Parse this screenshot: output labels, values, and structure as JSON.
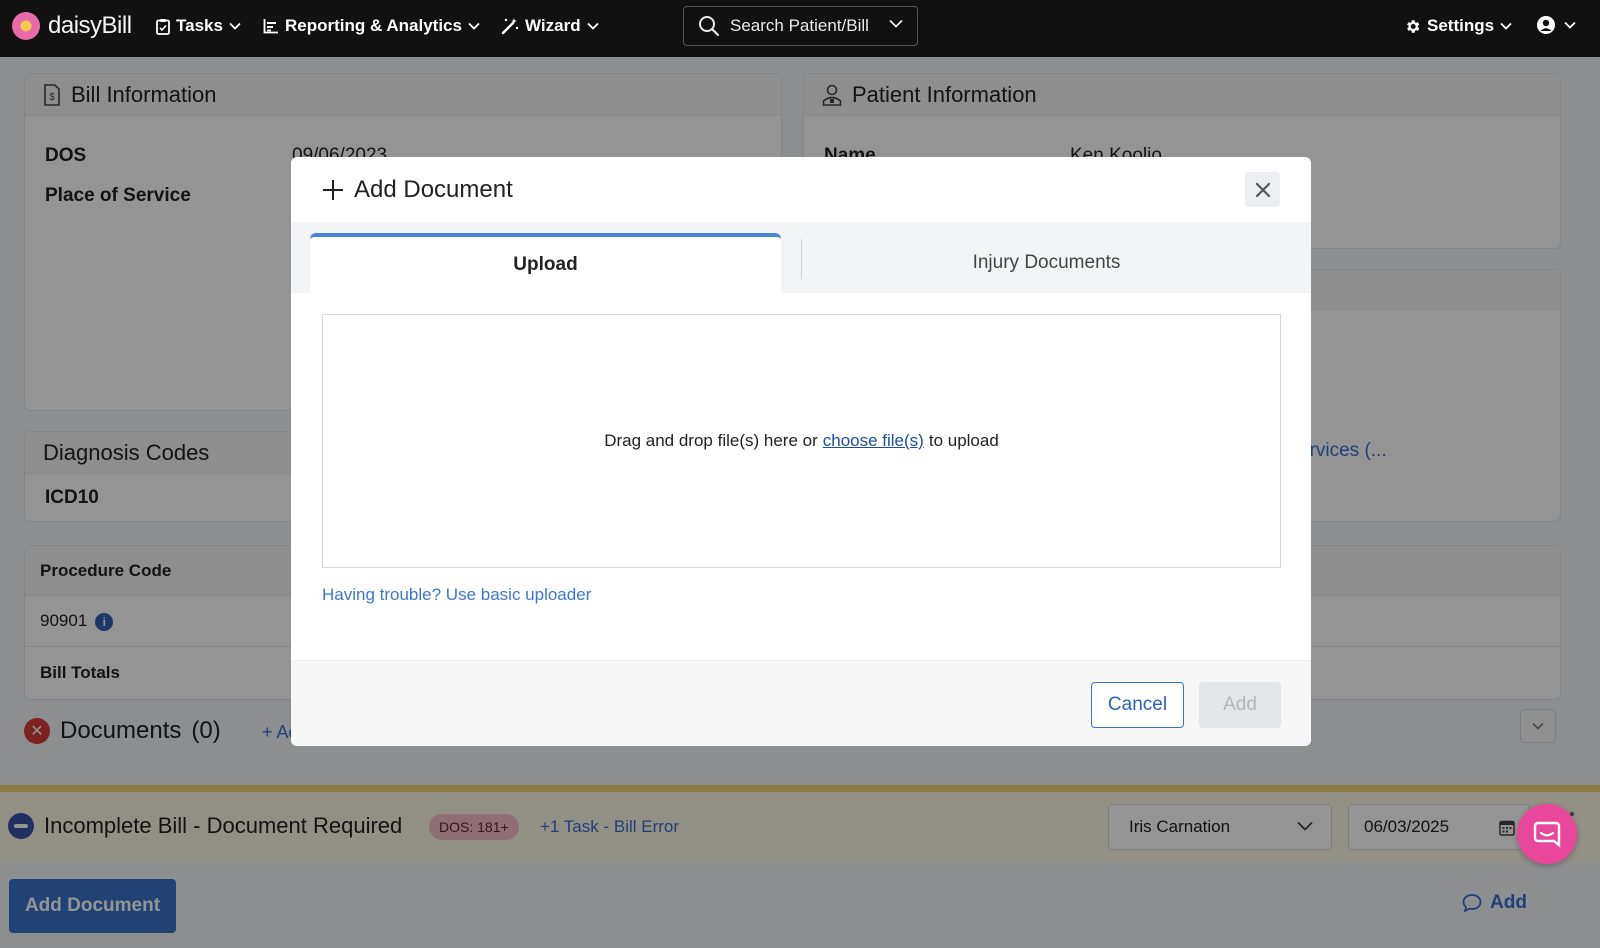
{
  "nav": {
    "brand": "daisyBill",
    "tasks": "Tasks",
    "reporting": "Reporting & Analytics",
    "wizard": "Wizard",
    "search_placeholder": "Search Patient/Bill",
    "settings": "Settings"
  },
  "bill_info": {
    "title": "Bill Information",
    "dos_label": "DOS",
    "dos_value": "09/06/2023",
    "pos_label": "Place of Service"
  },
  "patient_info": {
    "title": "Patient Information",
    "name_label": "Name",
    "name_value": "Ken Koolio",
    "services_link": "ervices (..."
  },
  "diagnosis": {
    "title": "Diagnosis Codes",
    "icd_label": "ICD10"
  },
  "procedures": {
    "header": "Procedure Code",
    "code": "90901",
    "totals_label": "Bill Totals"
  },
  "documents": {
    "title": "Documents",
    "count": "(0)",
    "add_label": "+ Add"
  },
  "status_bar": {
    "title": "Incomplete Bill - Document Required",
    "dos_badge": "DOS: 181+",
    "task_link": "+1 Task - Bill Error",
    "assignee": "Iris Carnation",
    "date": "06/03/2025"
  },
  "bottom": {
    "add_document": "Add Document",
    "right_link": "Add"
  },
  "modal": {
    "title": "Add Document",
    "tab_upload": "Upload",
    "tab_injury": "Injury Documents",
    "dropzone_text_before": "Drag and drop file(s) here or",
    "dropzone_link": "choose file(s)",
    "dropzone_text_after": "to upload",
    "basic_uploader": "Having trouble? Use basic uploader",
    "cancel": "Cancel",
    "add": "Add"
  },
  "colors": {
    "accent": "#3a72c8",
    "tab_active_border": "#4a86d6",
    "chat": "#e8479a",
    "badge": "#f6bfcc"
  }
}
